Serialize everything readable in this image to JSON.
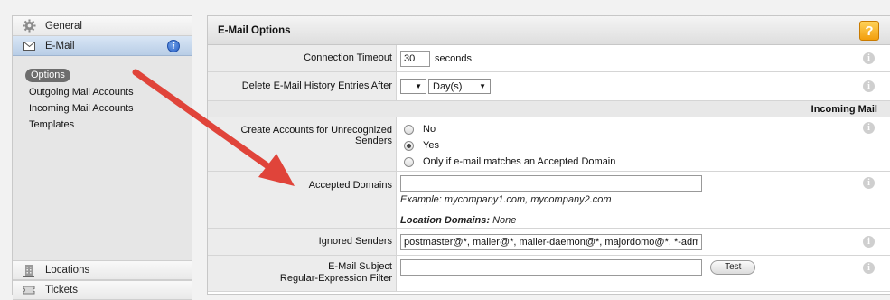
{
  "sidebar": {
    "nav_items": [
      {
        "label": "General",
        "icon": "gear-icon"
      },
      {
        "label": "E-Mail",
        "icon": "envelope-icon",
        "badge": "i"
      }
    ],
    "subnav": [
      {
        "label": "Options"
      },
      {
        "label": "Outgoing Mail Accounts"
      },
      {
        "label": "Incoming Mail Accounts"
      },
      {
        "label": "Templates"
      }
    ],
    "bottom_items": [
      {
        "label": "Locations",
        "icon": "building-icon"
      },
      {
        "label": "Tickets",
        "icon": "ticket-icon"
      }
    ]
  },
  "panel": {
    "title": "E-Mail Options",
    "help": "?",
    "connection_timeout": {
      "label": "Connection Timeout",
      "value": "30",
      "unit": "seconds"
    },
    "delete_history": {
      "label": "Delete E-Mail History Entries After",
      "number": "",
      "unit": "Day(s)"
    },
    "incoming_section": "Incoming Mail",
    "create_accounts": {
      "label": "Create Accounts for Unrecognized Senders",
      "options": [
        "No",
        "Yes",
        "Only if e-mail matches an Accepted Domain"
      ],
      "selected_index": 1
    },
    "accepted_domains": {
      "label": "Accepted Domains",
      "value": "",
      "example": "Example: mycompany1.com, mycompany2.com",
      "location_domains_label": "Location Domains:",
      "location_domains_value": "None"
    },
    "ignored_senders": {
      "label": "Ignored Senders",
      "value": "postmaster@*, mailer@*, mailer-daemon@*, majordomo@*, *-admin"
    },
    "subject_filter": {
      "label_line1": "E-Mail Subject",
      "label_line2": "Regular-Expression Filter",
      "value": "",
      "test_label": "Test"
    },
    "info_glyph": "i"
  },
  "colors": {
    "arrow": "#e0443a",
    "help": "#f5a623",
    "selected_nav": "#c7d8ee"
  }
}
